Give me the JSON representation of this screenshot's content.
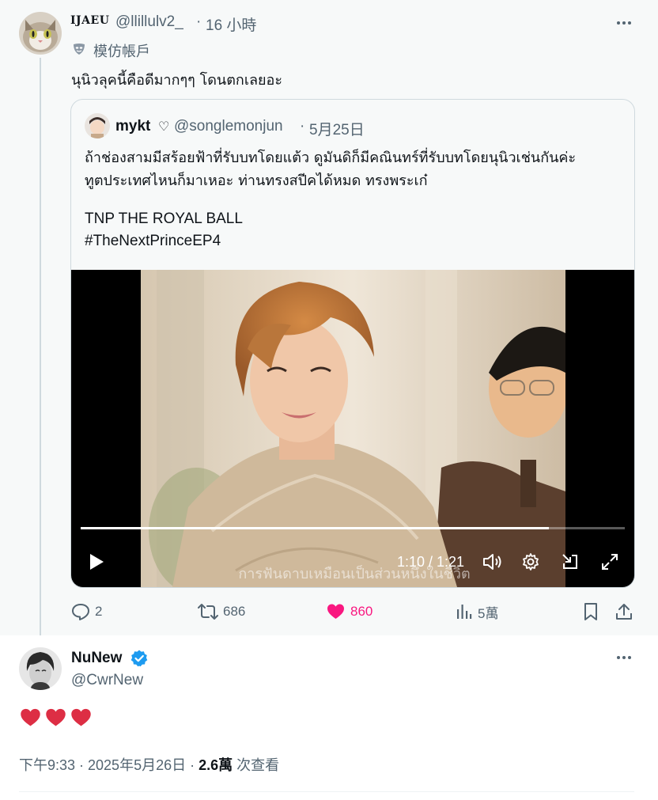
{
  "reply": {
    "display_name": "IJAEU",
    "handle": "@llillulv2_",
    "time": "16 小時",
    "badge_label": "模仿帳戶",
    "text": "นุนิวลุคนี้คือดีมากๆๆ โดนตกเลยอะ"
  },
  "quote": {
    "display_name": "mykt",
    "heart_symbol": "♡",
    "handle": "@songlemonjun",
    "date": "5月25日",
    "line1": "ถ้าช่องสามมีสร้อยฟ้าที่รับบทโดยแต้ว ดูมันดิก็มีคณินทร์ที่รับบทโดยนุนิวเช่นกันค่ะ",
    "line2": "ทูตประเทศไหนก็มาเหอะ ท่านทรงสปีคได้หมด ทรงพระเก๋",
    "line3": "TNP THE ROYAL BALL",
    "line4": "#TheNextPrinceEP4",
    "video": {
      "time": "1:10 / 1:21",
      "progress": 0.86,
      "subtitle": "การฟันดาบเหมือนเป็นส่วนหนึ่งในชีวิต"
    }
  },
  "actions": {
    "replies": "2",
    "retweets": "686",
    "likes": "860",
    "views": "5萬"
  },
  "main": {
    "display_name": "NuNew",
    "handle": "@CwrNew",
    "body": "❤️❤️❤️",
    "timestamp": "下午9:33 · 2025年5月26日 · ",
    "views_count": "2.6萬",
    "views_label": " 次查看"
  },
  "colors": {
    "like": "#f91880",
    "verified": "#1d9bf0",
    "muted": "#536471"
  }
}
